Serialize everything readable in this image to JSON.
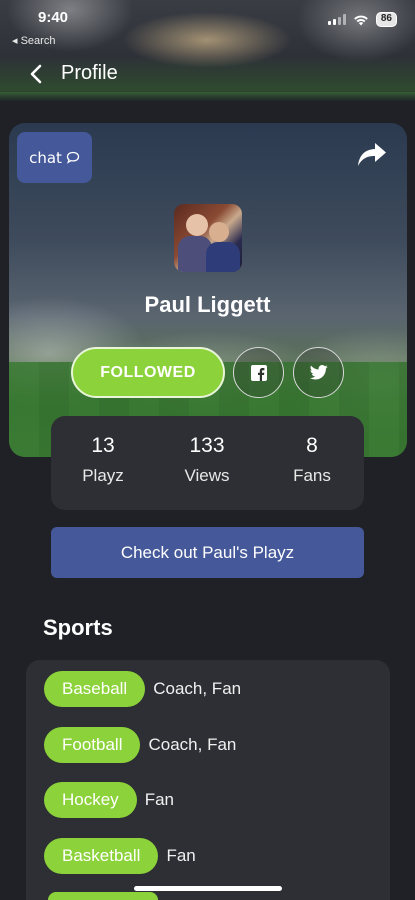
{
  "status_bar": {
    "time": "9:40",
    "back_label": "◂ Search",
    "battery": "86"
  },
  "nav": {
    "title": "Profile"
  },
  "profile": {
    "chat_label": "chat",
    "name": "Paul Liggett",
    "follow_label": "FOLLOWED",
    "stats": [
      {
        "value": "13",
        "label": "Playz"
      },
      {
        "value": "133",
        "label": "Views"
      },
      {
        "value": "8",
        "label": "Fans"
      }
    ],
    "playz_button_label": "Check out Paul's Playz"
  },
  "sports": {
    "title": "Sports",
    "items": [
      {
        "sport": "Baseball",
        "roles": "Coach, Fan"
      },
      {
        "sport": "Football",
        "roles": "Coach, Fan"
      },
      {
        "sport": "Hockey",
        "roles": "Fan"
      },
      {
        "sport": "Basketball",
        "roles": "Fan"
      }
    ]
  },
  "colors": {
    "accent_green": "#8cd23a",
    "button_blue": "#45599a",
    "background": "#1f2127",
    "card": "#2d2f34"
  },
  "icons": [
    "back-chevron-icon",
    "chat-bubble-icon",
    "share-icon",
    "facebook-icon",
    "twitter-icon",
    "wifi-icon",
    "signal-icon"
  ]
}
